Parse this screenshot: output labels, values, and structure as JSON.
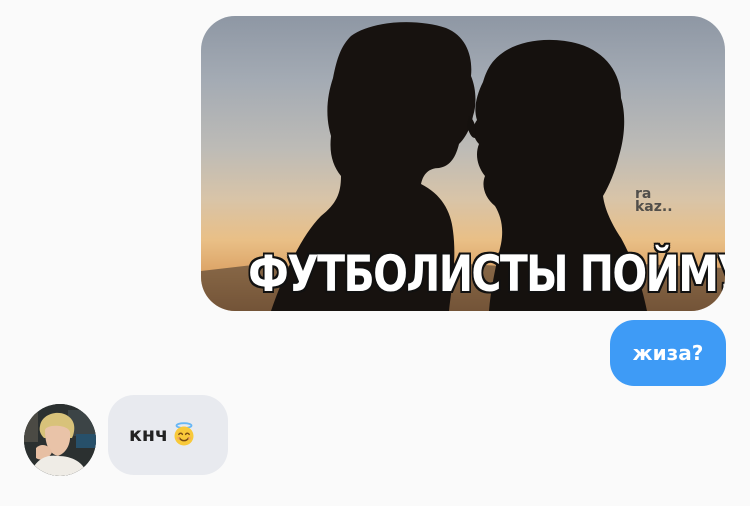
{
  "messages": {
    "sent_image": {
      "caption": "ФУТБОЛИСТЫ ПОЙМУТ",
      "watermark_line1": "ra",
      "watermark_line2": "kaz.."
    },
    "sent_text": "жиза?",
    "received_text": "кнч",
    "received_emoji": "smiling-face-with-halo-icon"
  },
  "colors": {
    "sent_bubble": "#3e9bf6",
    "received_bubble": "#e8eaef",
    "background": "#fafafa"
  }
}
